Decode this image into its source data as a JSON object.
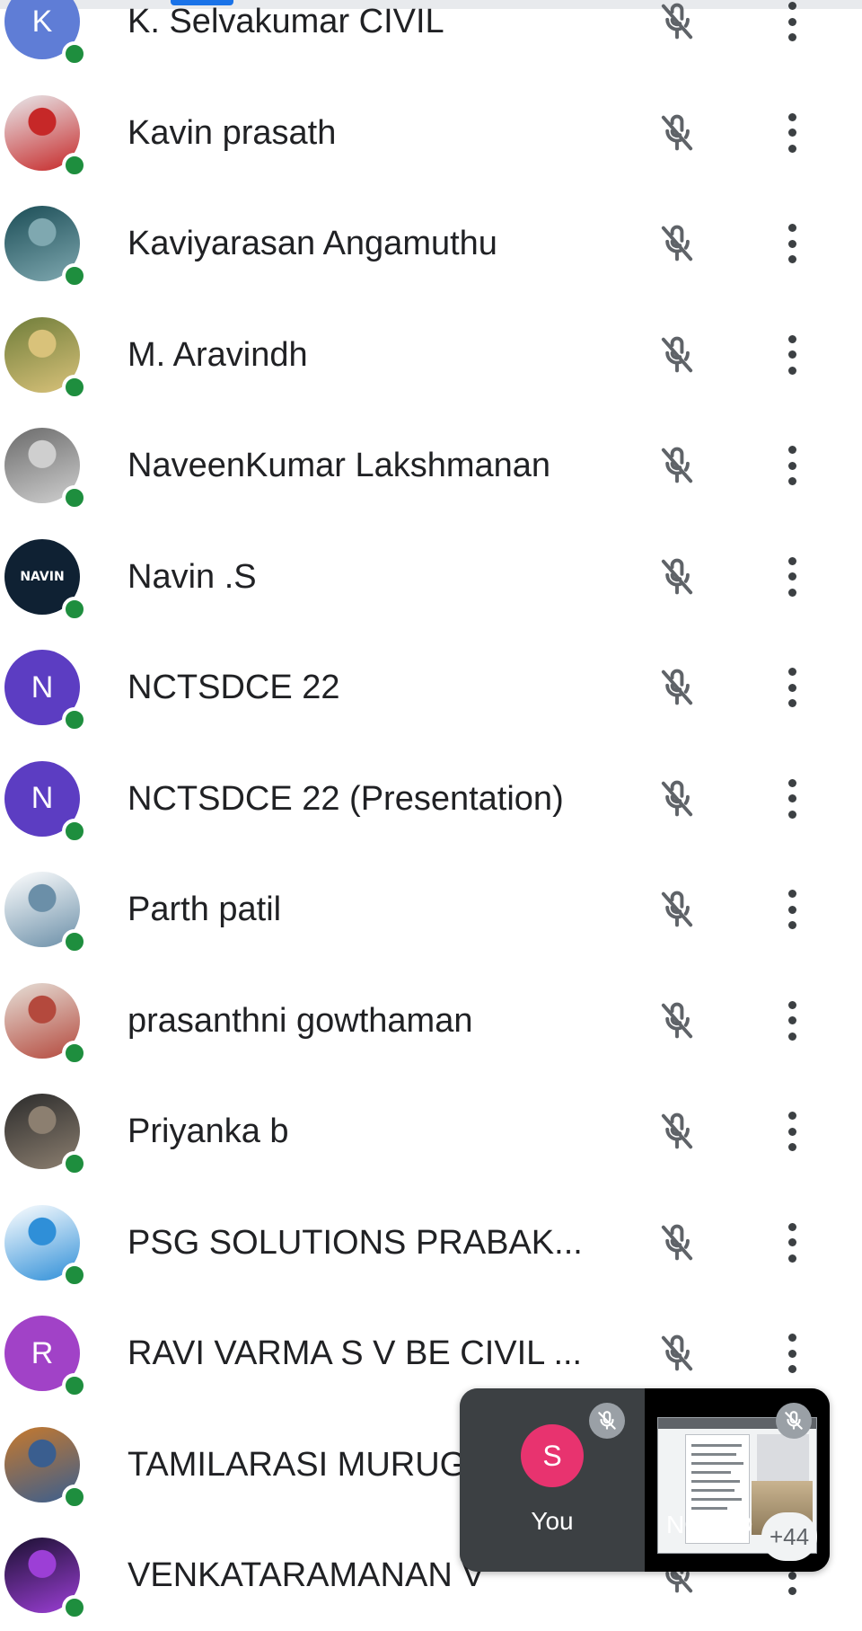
{
  "participants": [
    {
      "name": "K. Selvakumar CIVIL",
      "avatar_type": "initial",
      "initial": "K",
      "avatar_color": "#5f7dd6"
    },
    {
      "name": "Kavin prasath",
      "avatar_type": "photo",
      "photo_colors": [
        "#e8eaed",
        "#c62828"
      ]
    },
    {
      "name": "Kaviyarasan Angamuthu",
      "avatar_type": "photo",
      "photo_colors": [
        "#1b4d56",
        "#7fa8b0"
      ]
    },
    {
      "name": "M. Aravindh",
      "avatar_type": "photo",
      "photo_colors": [
        "#6f7d3a",
        "#d9c27a"
      ]
    },
    {
      "name": "NaveenKumar Lakshmanan",
      "avatar_type": "photo",
      "photo_colors": [
        "#6b6b6b",
        "#cfcfcf"
      ]
    },
    {
      "name": "Navin .S",
      "avatar_type": "logo",
      "logo_text": "NAVIN",
      "avatar_color": "#0f2133"
    },
    {
      "name": "NCTSDCE 22",
      "avatar_type": "initial",
      "initial": "N",
      "avatar_color": "#5c3dc2"
    },
    {
      "name": "NCTSDCE 22 (Presentation)",
      "avatar_type": "initial",
      "initial": "N",
      "avatar_color": "#5c3dc2"
    },
    {
      "name": "Parth patil",
      "avatar_type": "photo",
      "photo_colors": [
        "#ffffff",
        "#6b8fa8"
      ]
    },
    {
      "name": "prasanthni gowthaman",
      "avatar_type": "photo",
      "photo_colors": [
        "#e6e0d8",
        "#b4493d"
      ]
    },
    {
      "name": "Priyanka b",
      "avatar_type": "photo",
      "photo_colors": [
        "#2b2b2b",
        "#8c7f70"
      ]
    },
    {
      "name": "PSG SOLUTIONS PRABAK...",
      "avatar_type": "photo",
      "photo_colors": [
        "#ffffff",
        "#2f8fd8"
      ]
    },
    {
      "name": "RAVI VARMA S V BE CIVIL ...",
      "avatar_type": "initial",
      "initial": "R",
      "avatar_color": "#a142c7"
    },
    {
      "name": "TAMILARASI MURUG",
      "avatar_type": "photo",
      "photo_colors": [
        "#c7792c",
        "#3a5e8f"
      ]
    },
    {
      "name": "VENKATARAMANAN V",
      "avatar_type": "photo",
      "photo_colors": [
        "#1a1030",
        "#9c3fd6"
      ]
    }
  ],
  "pip": {
    "self_initial": "S",
    "self_label": "You",
    "other_label": "NCTSD",
    "more_count": "+44"
  },
  "colors": {
    "online_dot": "#1e8e3e",
    "mic_muted": "#5f6368",
    "self_avatar": "#e8336f"
  }
}
